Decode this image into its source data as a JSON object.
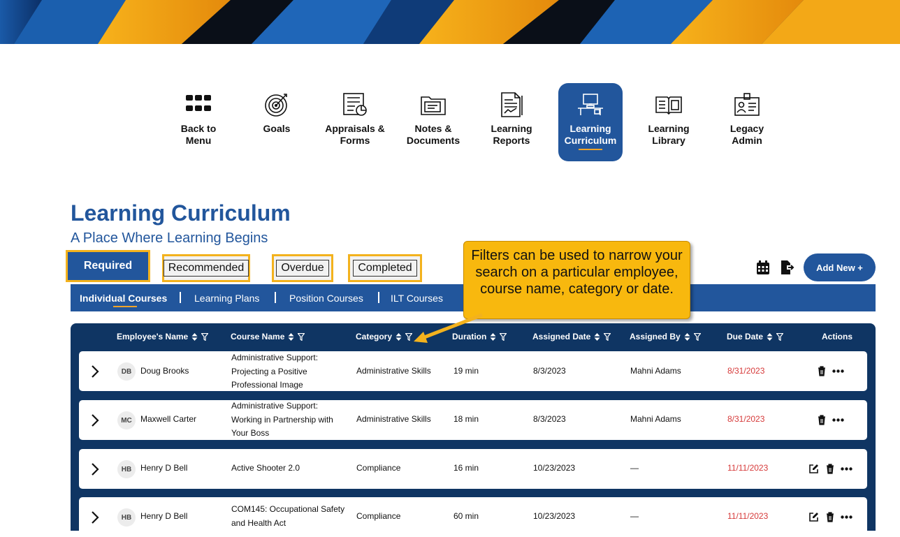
{
  "nav": {
    "items": [
      {
        "label": "Back to\nMenu",
        "icon": "grid-icon"
      },
      {
        "label": "Goals",
        "icon": "target-icon"
      },
      {
        "label": "Appraisals &\nForms",
        "icon": "appraisal-form-icon"
      },
      {
        "label": "Notes &\nDocuments",
        "icon": "folder-icon"
      },
      {
        "label": "Learning\nReports",
        "icon": "report-icon"
      },
      {
        "label": "Learning\nCurriculum",
        "icon": "desk-computer-icon",
        "active": true
      },
      {
        "label": "Learning\nLibrary",
        "icon": "open-book-icon"
      },
      {
        "label": "Legacy\nAdmin",
        "icon": "id-badge-icon"
      }
    ]
  },
  "page": {
    "title": "Learning Curriculum",
    "subtitle": "A Place Where Learning Begins"
  },
  "tabs": {
    "required": "Required",
    "recommended": "Recommended",
    "overdue": "Overdue",
    "completed": "Completed"
  },
  "toolbar": {
    "add_new": "Add New +",
    "calendar_icon": "calendar-icon",
    "export_icon": "export-icon"
  },
  "subnav": {
    "items": [
      "Individual Courses",
      "Learning Plans",
      "Position Courses",
      "ILT Courses"
    ]
  },
  "callout": {
    "text": "Filters can be used to narrow your search on a particular employee, course name, category or date."
  },
  "table": {
    "headers": [
      "Employee's Name",
      "Course Name",
      "Category",
      "Duration",
      "Assigned Date",
      "Assigned By",
      "Due Date",
      "Actions"
    ],
    "rows": [
      {
        "initials": "DB",
        "name": "Doug Brooks",
        "course": "Administrative Support: Projecting a Positive Professional Image",
        "category": "Administrative Skills",
        "duration": "19 min",
        "assigned_date": "8/3/2023",
        "assigned_by": "Mahni Adams",
        "due_date": "8/31/2023"
      },
      {
        "initials": "MC",
        "name": "Maxwell Carter",
        "course": "Administrative Support: Working in Partnership with Your Boss",
        "category": "Administrative Skills",
        "duration": "18 min",
        "assigned_date": "8/3/2023",
        "assigned_by": "Mahni Adams",
        "due_date": "8/31/2023"
      },
      {
        "initials": "HB",
        "name": "Henry D Bell",
        "course": "Active Shooter 2.0",
        "category": "Compliance",
        "duration": "16 min",
        "assigned_date": "10/23/2023",
        "assigned_by": "—",
        "due_date": "11/11/2023"
      },
      {
        "initials": "HB",
        "name": "Henry D Bell",
        "course": "COM145: Occupational Safety and Health Act",
        "category": "Compliance",
        "duration": "60 min",
        "assigned_date": "10/23/2023",
        "assigned_by": "—",
        "due_date": "11/11/2023"
      }
    ]
  },
  "colors": {
    "brand_blue": "#22569c",
    "table_navy": "#0f3563",
    "highlight_gold": "#f3b21d",
    "due_red": "#d63a3a"
  }
}
